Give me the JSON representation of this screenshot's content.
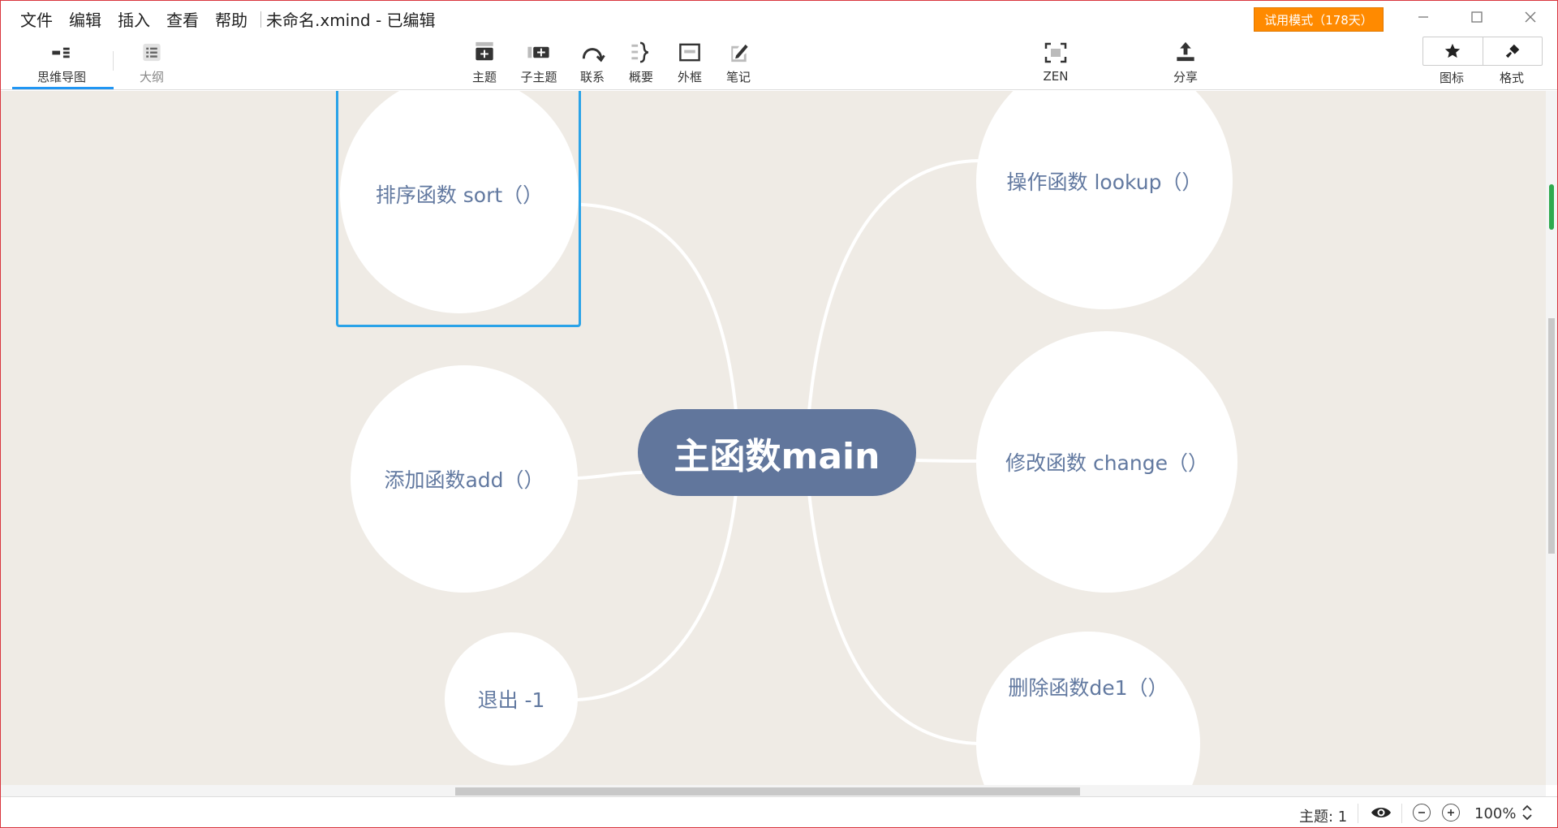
{
  "menu": {
    "items": [
      "文件",
      "编辑",
      "插入",
      "查看",
      "帮助"
    ],
    "document_title": "未命名.xmind - 已编辑"
  },
  "trial_label": "试用模式（178天）",
  "toolbar": {
    "views": [
      {
        "label": "思维导图",
        "icon": "mindmap-icon"
      },
      {
        "label": "大纲",
        "icon": "outline-icon"
      }
    ],
    "insert_tools": [
      {
        "label": "主题",
        "icon": "topic-icon"
      },
      {
        "label": "子主题",
        "icon": "subtopic-icon"
      },
      {
        "label": "联系",
        "icon": "relationship-icon"
      },
      {
        "label": "概要",
        "icon": "summary-icon"
      },
      {
        "label": "外框",
        "icon": "boundary-icon"
      },
      {
        "label": "笔记",
        "icon": "notes-icon"
      }
    ],
    "zen_label": "ZEN",
    "share_label": "分享",
    "icons_label": "图标",
    "format_label": "格式"
  },
  "mindmap": {
    "central": "主函数main",
    "topics": {
      "sort": "排序函数 sort（）",
      "add": "添加函数add（）",
      "exit": "退出 -1",
      "lookup": "操作函数 lookup（）",
      "change": "修改函数 change（）",
      "del": "删除函数de1（）"
    }
  },
  "status": {
    "topic_count": "主题: 1",
    "zoom": "100%"
  },
  "colors": {
    "canvas": "#efebe5",
    "central_fill": "#61769c",
    "topic_text": "#6279a0",
    "selection": "#2aa3e8",
    "trial": "#ff8a00",
    "view_active": "#2196f3"
  }
}
